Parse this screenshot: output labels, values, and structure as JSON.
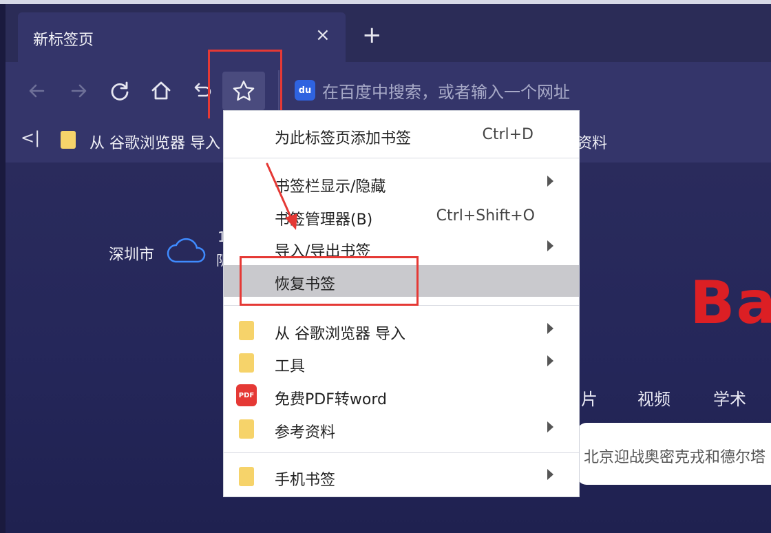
{
  "window": {
    "tab_title": "新标签页",
    "new_tab_glyph": "+",
    "close_glyph": "×"
  },
  "toolbar": {
    "icons": [
      "back-icon",
      "forward-icon",
      "reload-icon",
      "home-icon",
      "undo-close-tab-icon",
      "star-icon"
    ],
    "search_engine_icon": "du",
    "address_placeholder": "在百度中搜索，或者输入一个网址"
  },
  "bookmarks_bar": {
    "left_glyph": "<|",
    "item1": "从 谷歌浏览器 导入",
    "item2_tail": "资料"
  },
  "page": {
    "city": "深圳市",
    "weather_top": "1",
    "weather_bottom": "阴",
    "baidu_logo_text": "Ba",
    "nav": [
      "图片",
      "视频",
      "学术"
    ],
    "search_suggestion": "北京迎战奥密克戎和德尔塔"
  },
  "menu": {
    "items": [
      {
        "label": "为此标签页添加书签",
        "shortcut": "Ctrl+D"
      },
      {
        "label": "书签栏显示/隐藏",
        "arrow": true
      },
      {
        "label": "书签管理器(B)",
        "shortcut": "Ctrl+Shift+O"
      },
      {
        "label": "导入/导出书签",
        "arrow": true
      },
      {
        "label": "恢复书签",
        "hovered": true
      },
      {
        "label": "从 谷歌浏览器 导入",
        "icon": "folder-icon",
        "arrow": true
      },
      {
        "label": "工具",
        "icon": "folder-icon",
        "arrow": true
      },
      {
        "label": "免费PDF转word",
        "icon": "pdf-icon",
        "icon_text": "PDF"
      },
      {
        "label": "参考资料",
        "icon": "folder-icon",
        "arrow": true
      },
      {
        "label": "手机书签",
        "icon": "folder-icon",
        "arrow": true
      }
    ]
  },
  "colors": {
    "highlight": "#e53935",
    "baidu_red": "#dc1f24",
    "menu_hover": "#c9c9cd"
  }
}
